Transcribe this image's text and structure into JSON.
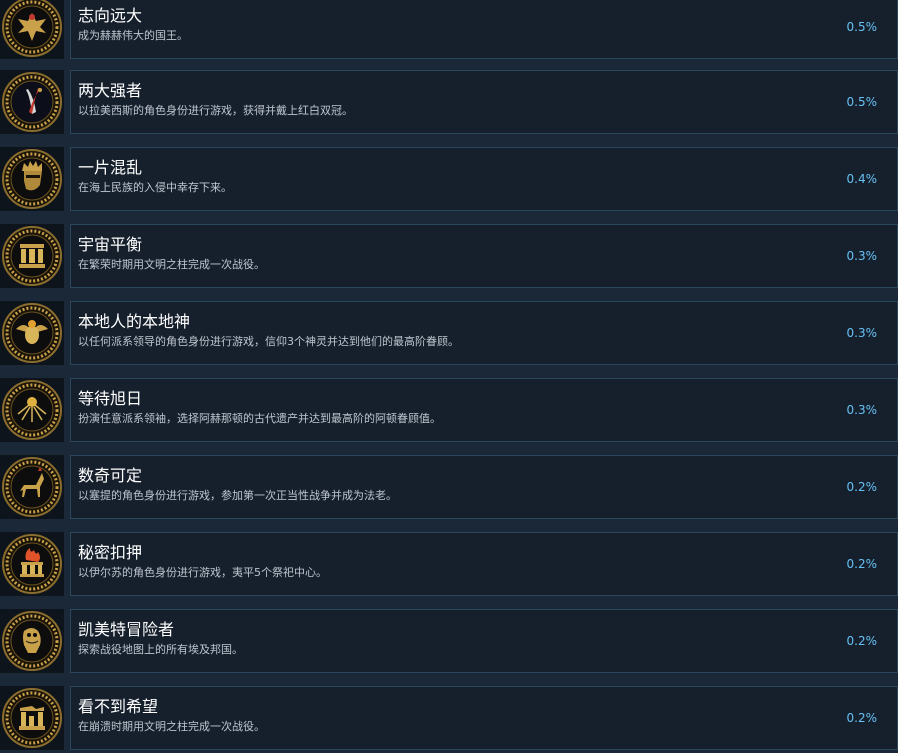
{
  "achievements": [
    {
      "title": "志向远大",
      "desc": "成为赫赫伟大的国王。",
      "pct": "0.5%",
      "icon": "eagle-emblem-icon"
    },
    {
      "title": "两大强者",
      "desc": "以拉美西斯的角色身份进行游戏，获得并戴上红白双冠。",
      "pct": "0.5%",
      "icon": "double-crown-icon"
    },
    {
      "title": "一片混乱",
      "desc": "在海上民族的入侵中幸存下来。",
      "pct": "0.4%",
      "icon": "warrior-head-icon"
    },
    {
      "title": "宇宙平衡",
      "desc": "在繁荣时期用文明之柱完成一次战役。",
      "pct": "0.3%",
      "icon": "temple-pillars-icon"
    },
    {
      "title": "本地人的本地神",
      "desc": "以任何派系领导的角色身份进行游戏，信仰3个神灵并达到他们的最高阶眷顾。",
      "pct": "0.3%",
      "icon": "scarab-icon"
    },
    {
      "title": "等待旭日",
      "desc": "扮演任意派系领袖，选择阿赫那顿的古代遗产并达到最高阶的阿顿眷顾值。",
      "pct": "0.3%",
      "icon": "aten-sun-icon"
    },
    {
      "title": "数奇可定",
      "desc": "以塞提的角色身份进行游戏，参加第一次正当性战争并成为法老。",
      "pct": "0.2%",
      "icon": "jackal-icon"
    },
    {
      "title": "秘密扣押",
      "desc": "以伊尔苏的角色身份进行游戏，夷平5个祭祀中心。",
      "pct": "0.2%",
      "icon": "burning-temple-icon"
    },
    {
      "title": "凯美特冒险者",
      "desc": "探索战役地图上的所有埃及邦国。",
      "pct": "0.2%",
      "icon": "owl-icon"
    },
    {
      "title": "看不到希望",
      "desc": "在崩溃时期用文明之柱完成一次战役。",
      "pct": "0.2%",
      "icon": "ruined-pillars-icon"
    }
  ]
}
